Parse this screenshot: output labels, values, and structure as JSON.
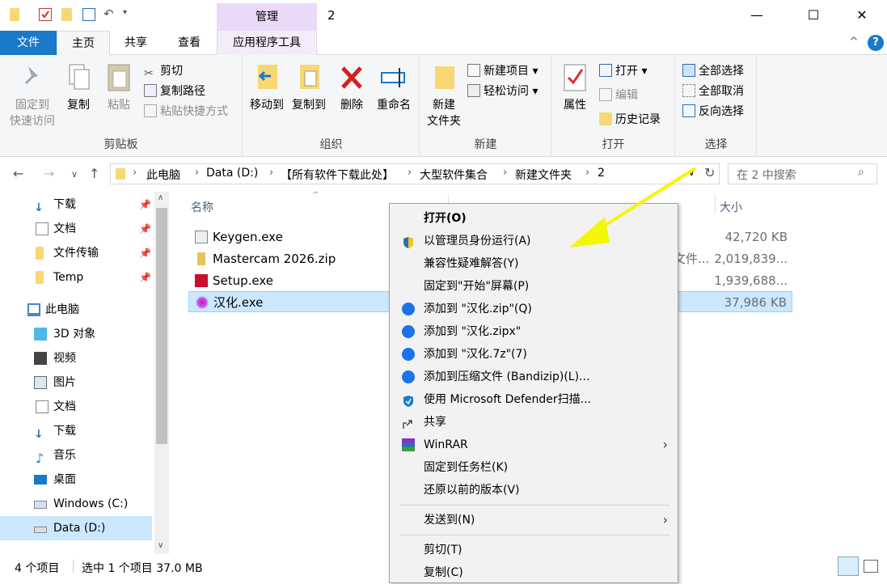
{
  "titlebar": {
    "context_tab": "管理",
    "title": "2",
    "minimize": "—",
    "maximize": "☐",
    "close": "✕"
  },
  "tabs": {
    "file": "文件",
    "home": "主页",
    "share": "共享",
    "view": "查看",
    "app_tools": "应用程序工具",
    "collapse_ribbon": "^",
    "help": "?"
  },
  "ribbon": {
    "clipboard": {
      "label": "剪贴板",
      "pin_quick_access": [
        "固定到",
        "快速访问"
      ],
      "copy": "复制",
      "paste": "粘贴",
      "cut": "剪切",
      "copy_path": "复制路径",
      "paste_shortcut": "粘贴快捷方式"
    },
    "organize": {
      "label": "组织",
      "move_to": "移动到",
      "copy_to": "复制到",
      "delete": "删除",
      "rename": "重命名"
    },
    "new": {
      "label": "新建",
      "new_folder": [
        "新建",
        "文件夹"
      ],
      "new_item": "新建项目",
      "easy_access": "轻松访问"
    },
    "open": {
      "label": "打开",
      "properties": "属性",
      "open": "打开",
      "edit": "编辑",
      "history": "历史记录"
    },
    "select": {
      "label": "选择",
      "select_all": "全部选择",
      "select_none": "全部取消",
      "invert": "反向选择"
    }
  },
  "address": {
    "crumbs": [
      "此电脑",
      "Data (D:)",
      "【所有软件下载此处】",
      "大型软件集合",
      "新建文件夹",
      "2"
    ],
    "search_placeholder": "在 2 中搜索"
  },
  "nav": {
    "quick": [
      {
        "label": "下载",
        "pinned": true
      },
      {
        "label": "文档",
        "pinned": true
      },
      {
        "label": "文件传输",
        "pinned": true
      },
      {
        "label": "Temp",
        "pinned": true
      }
    ],
    "this_pc": "此电脑",
    "pc_items": [
      "3D 对象",
      "视频",
      "图片",
      "文档",
      "下载",
      "音乐",
      "桌面",
      "Windows (C:)",
      "Data (D:)"
    ]
  },
  "filelist": {
    "col_name": "名称",
    "col_size": "大小",
    "files": [
      {
        "name": "Keygen.exe",
        "type": "",
        "size": "42,720 KB"
      },
      {
        "name": "Mastercam 2026.zip",
        "type": "文件...",
        "size": "2,019,839..."
      },
      {
        "name": "Setup.exe",
        "type": "",
        "size": "1,939,688..."
      },
      {
        "name": "汉化.exe",
        "type": "",
        "size": "37,986 KB",
        "selected": true
      }
    ]
  },
  "status": {
    "count": "4 个项目",
    "selection": "选中 1 个项目 37.0 MB"
  },
  "context_menu": {
    "items": [
      {
        "label": "打开(O)",
        "bold": true
      },
      {
        "label": "以管理员身份运行(A)",
        "icon": "uac-shield-icon"
      },
      {
        "label": "兼容性疑难解答(Y)"
      },
      {
        "label": "固定到\"开始\"屏幕(P)"
      },
      {
        "label": "添加到 \"汉化.zip\"(Q)",
        "icon": "bandizip-icon"
      },
      {
        "label": "添加到 \"汉化.zipx\"",
        "icon": "bandizip-icon"
      },
      {
        "label": "添加到 \"汉化.7z\"(7)",
        "icon": "bandizip-icon"
      },
      {
        "label": "添加到压缩文件 (Bandizip)(L)...",
        "icon": "bandizip-icon"
      },
      {
        "label": "使用 Microsoft Defender扫描...",
        "icon": "defender-icon"
      },
      {
        "label": "共享",
        "icon": "share-icon"
      },
      {
        "label": "WinRAR",
        "icon": "winrar-icon",
        "submenu": true
      },
      {
        "label": "固定到任务栏(K)"
      },
      {
        "label": "还原以前的版本(V)"
      },
      {
        "label": "发送到(N)",
        "submenu": true
      },
      {
        "label": "剪切(T)"
      },
      {
        "label": "复制(C)"
      }
    ]
  },
  "colors": {
    "file_tab": "#1979ca",
    "manage_tab": "#ead9f7",
    "selection": "#cce8ff",
    "annotation_arrow": "#f5f50a"
  }
}
